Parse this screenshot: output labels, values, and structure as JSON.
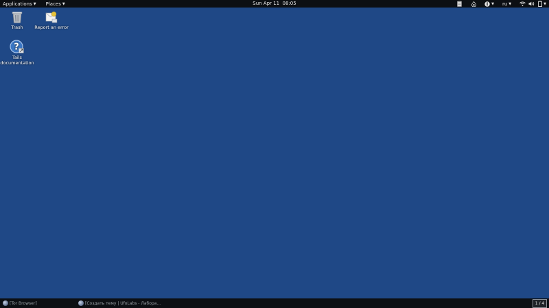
{
  "top_panel": {
    "applications_label": "Applications",
    "places_label": "Places",
    "clock": "Sun Apr 11  08:05",
    "tray": {
      "clipboard_icon": "clipboard-icon",
      "tor_onion_icon": "onion-icon",
      "accessibility_icon": "accessibility-icon",
      "keyboard_layout": "ru",
      "network_icon": "wifi-icon",
      "volume_icon": "volume-icon",
      "power_icon": "battery-icon"
    }
  },
  "desktop": {
    "icons": [
      {
        "label": "Trash",
        "icon": "trash-icon"
      },
      {
        "label": "Report an error",
        "icon": "report-error-icon"
      },
      {
        "label": "Tails documentation",
        "icon": "help-icon"
      }
    ]
  },
  "bottom_panel": {
    "tasks": [
      {
        "label": "[Tor Browser]"
      },
      {
        "label": "[Создать тему | UfoLabs - Лабора..."
      }
    ],
    "workspace": "1 / 4"
  },
  "colors": {
    "desktop_background": "#1f4886",
    "panel_background": "#0c0f13"
  }
}
